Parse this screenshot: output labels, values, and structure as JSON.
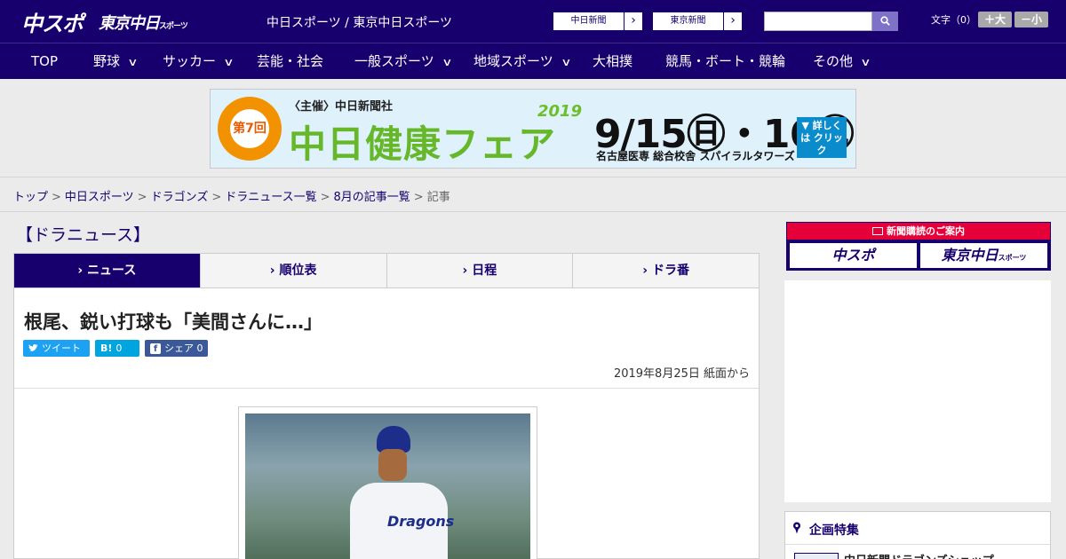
{
  "header": {
    "logo_main": "中スポ",
    "logo_tokyo": "東京中日",
    "logo_tokyo_small": "スポーツ",
    "site_links": "中日スポーツ / 東京中日スポーツ",
    "paper_buttons": [
      {
        "label": "中日新聞",
        "arrow": "›"
      },
      {
        "label": "東京新聞",
        "arrow": "›"
      }
    ],
    "search_placeholder": "",
    "search_icon": "magnifier-icon",
    "font_size_label": "文字（0）",
    "font_size_up": "＋大",
    "font_size_down": "－小"
  },
  "nav": {
    "items": [
      {
        "label": "TOP",
        "chevron": ""
      },
      {
        "label": "野球",
        "chevron": "∨"
      },
      {
        "label": "サッカー",
        "chevron": "∨"
      },
      {
        "label": "芸能・社会",
        "chevron": ""
      },
      {
        "label": "一般スポーツ",
        "chevron": "∨"
      },
      {
        "label": "地域スポーツ",
        "chevron": "∨"
      },
      {
        "label": "大相撲",
        "chevron": ""
      },
      {
        "label": "競馬・ボート・競輪",
        "chevron": ""
      },
      {
        "label": "その他",
        "chevron": "∨"
      }
    ]
  },
  "banner": {
    "host": "〈主催〉中日新聞社",
    "badge": "第7回",
    "title": "中日健康フェア",
    "year": "2019",
    "dates": "9/15㊐・16㊗",
    "venue": "名古屋医専 総合校舎 スパイラルタワーズ",
    "cta": "▼ 詳しくは クリック"
  },
  "breadcrumb": {
    "items": [
      "トップ",
      "中日スポーツ",
      "ドラゴンズ",
      "ドラニュース一覧",
      "8月の記事一覧"
    ],
    "current": "記事",
    "separator": ">"
  },
  "main": {
    "section_title": "【ドラニュース】",
    "tabs": [
      {
        "label": "ニュース",
        "active": true
      },
      {
        "label": "順位表",
        "active": false
      },
      {
        "label": "日程",
        "active": false
      },
      {
        "label": "ドラ番",
        "active": false
      }
    ],
    "tab_chevron": "›",
    "headline": "根尾、鋭い打球も「美間さんに…」",
    "share": {
      "tweet_icon": "twitter-bird-icon",
      "tweet": "ツイート",
      "hatena_icon": "B!",
      "hatena_count": "0",
      "facebook_icon": "f",
      "facebook": "シェア 0"
    },
    "date_line": "2019年8月25日 紙面から",
    "photo_jersey": "Dragons"
  },
  "sidebar": {
    "subscription_head": "新聞購読のご案内",
    "subscription_buttons": [
      "中スポ",
      "東京中日"
    ],
    "subscription_small": "スポーツ",
    "feature_title": "企画特集",
    "feature_item": "中日新聞ドラゴンズショップ"
  },
  "colors": {
    "brand_navy": "#17006e",
    "subscription_red": "#e5003a",
    "twitter_blue": "#1da1f2",
    "hatena_blue": "#00a4de",
    "facebook_blue": "#3b5998"
  }
}
